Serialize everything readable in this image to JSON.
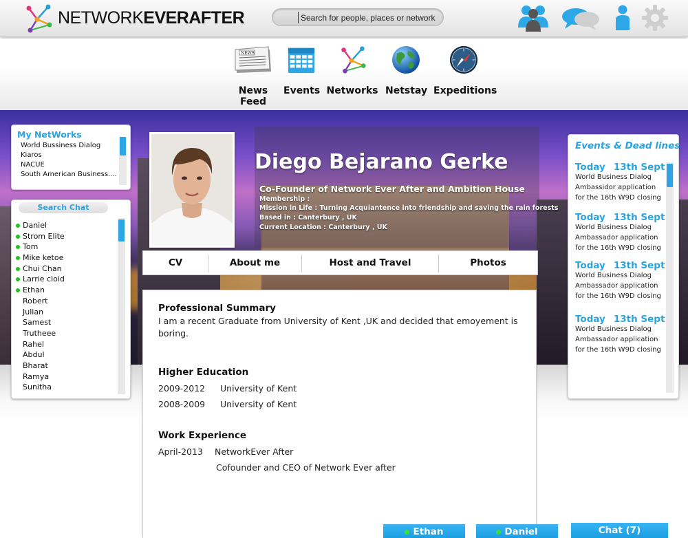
{
  "brand": {
    "part1": "NETWORK",
    "part2": "EVERAFTER"
  },
  "search": {
    "placeholder": "Search for people, places or network"
  },
  "top_icons": [
    "friends-icon",
    "messages-icon",
    "profile-icon",
    "gear-icon"
  ],
  "nav": [
    {
      "label": "News Feed",
      "icon": "newspaper-icon"
    },
    {
      "label": "Events",
      "icon": "calendar-icon"
    },
    {
      "label": "Networks",
      "icon": "network-icon"
    },
    {
      "label": "Netstay",
      "icon": "globe-icon"
    },
    {
      "label": "Expeditions",
      "icon": "compass-icon"
    }
  ],
  "my_networks": {
    "title": "My NetWorks",
    "items": [
      "World Bussiness Dialog",
      "Kiaros",
      "NACUE",
      "South American Business...."
    ]
  },
  "search_chat": {
    "title": "Search Chat",
    "online": [
      "Daniel",
      "Strom Elite",
      "Tom",
      "Mike ketoe",
      "Chui Chan",
      "Larrie cloid",
      "Ethan"
    ],
    "offline": [
      "Robert",
      "Julian",
      "Samest",
      "Trutheee",
      "Rahel",
      "Abdul",
      "Bharat",
      "Ramya",
      "Sunitha"
    ]
  },
  "profile": {
    "name": "Diego Bejarano Gerke",
    "title": "Co-Founder of Network Ever After and Ambition House",
    "membership": "Membership :",
    "mission": "Mission in Life : Turning Acquiantence into friendship and saving the rain forests",
    "based": "Based in :  Canterbury , UK",
    "location": "Current Location : Canterbury , UK"
  },
  "tabs": [
    "CV",
    "About me",
    "Host and Travel",
    "Photos"
  ],
  "cv": {
    "summary_heading": "Professional Summary",
    "summary_line1": "I am a recent Graduate from University of Kent ,UK and decided that emoyement is",
    "summary_line2": "boring.",
    "education_heading": "Higher Education",
    "education": [
      {
        "years": "2009-2012",
        "school": "University of Kent"
      },
      {
        "years": "2008-2009",
        "school": "University of Kent"
      }
    ],
    "work_heading": "Work Experience",
    "work": {
      "date": "April-2013",
      "company": "NetworkEver After",
      "role": "Cofounder and CEO of Network Ever after"
    }
  },
  "events": {
    "title": "Events & Dead lines",
    "items": [
      {
        "day": "Today",
        "date": "13th Sept",
        "line1": "World Business Dialog",
        "line2": "Ambassidor application",
        "line3": "for the 16th W9D closing"
      },
      {
        "day": "Today",
        "date": "13th Sept",
        "line1": "World Business Dialog",
        "line2": "Ambassador application",
        "line3": "for the 16th W9D closing"
      },
      {
        "day": "Today",
        "date": "13th Sept",
        "line1": "World Business Dialog",
        "line2": "Ambassador application",
        "line3": "for the 16th W9D closing"
      },
      {
        "day": "Today",
        "date": "13th Sept",
        "line1": "World Business Dialog",
        "line2": "Ambassador application",
        "line3": "for the 16th W9D closing"
      }
    ]
  },
  "chat_bar": {
    "tab1": "Ethan",
    "tab2": "Daniel",
    "main": "Chat  (7)"
  },
  "colors": {
    "accent": "#2aa3e0",
    "online": "#1ec41e",
    "chat_button": "#24a8ea"
  }
}
